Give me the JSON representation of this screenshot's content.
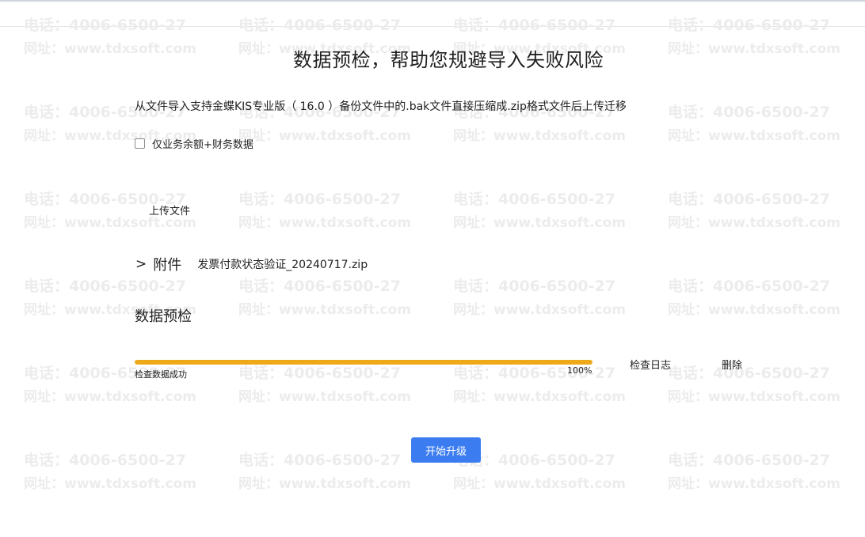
{
  "header": {
    "title": "数据预检，帮助您规避导入失败风险"
  },
  "description": "从文件导入支持金蝶KIS专业版（ 16.0 ）备份文件中的.bak文件直接压缩成.zip格式文件后上传迁移",
  "options": {
    "business_balance_label": "仅业务余额+财务数据",
    "business_balance_checked": false
  },
  "upload": {
    "button_label": "上传文件"
  },
  "attachment": {
    "chevron": ">",
    "label": "附件",
    "filename": "发票付款状态验证_20240717.zip"
  },
  "precheck": {
    "title": "数据预检",
    "progress_fraction": 1.0,
    "progress_percent": "100%",
    "status_text": "检查数据成功",
    "log_button_label": "检查日志",
    "delete_button_label": "删除"
  },
  "actions": {
    "start_upgrade_label": "开始升级"
  },
  "watermark": {
    "phone": "电话：4006-6500-27",
    "site": "网址：www.tdxsoft.com"
  },
  "colors": {
    "progress_bar": "#eda919",
    "primary_button": "#3b7cf0",
    "watermark": "#ececec"
  }
}
